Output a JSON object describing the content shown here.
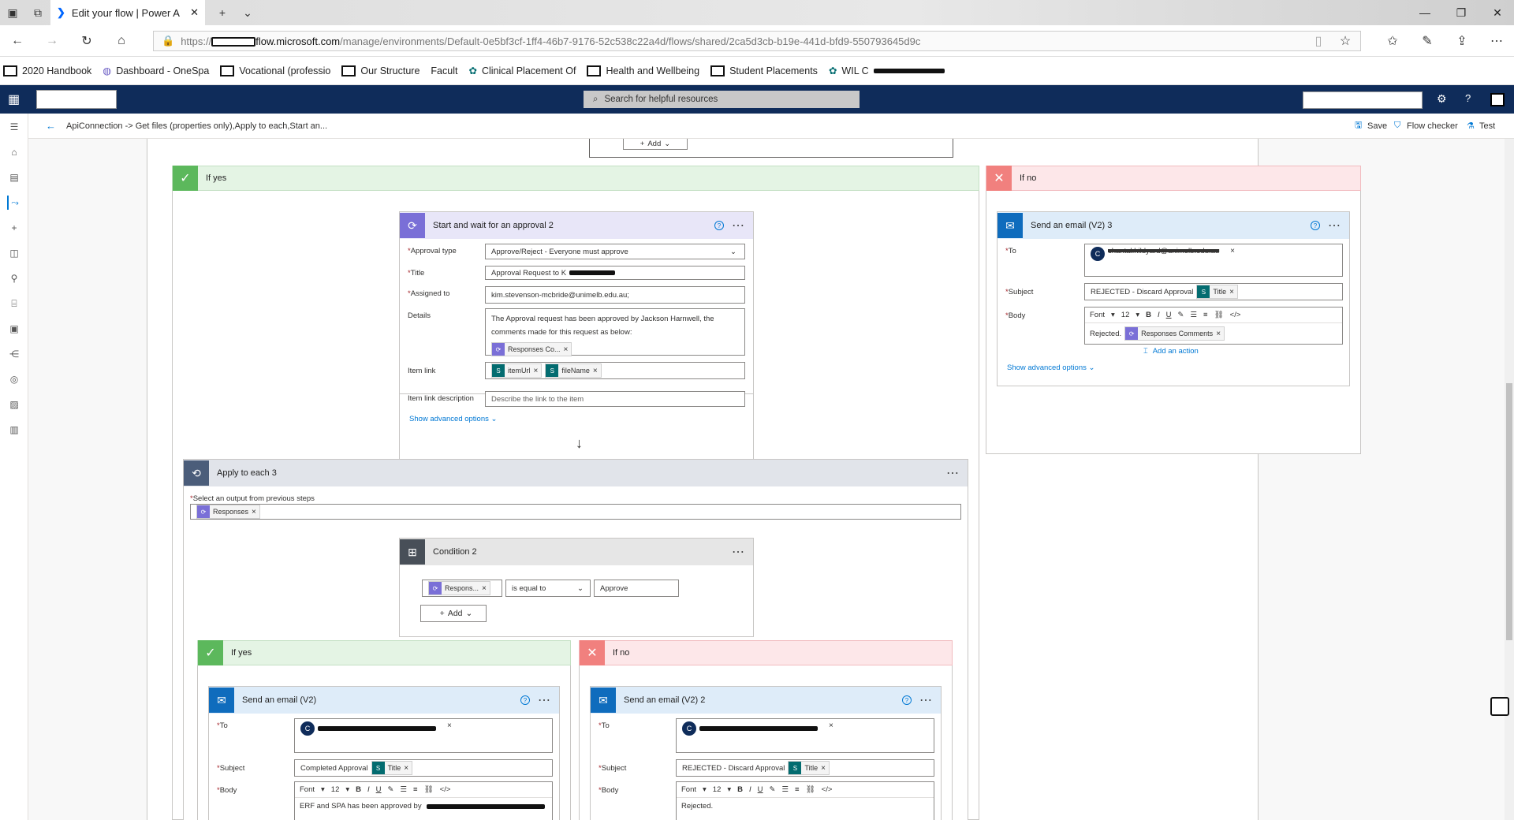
{
  "browser": {
    "tab_title": "Edit your flow | Power A",
    "url_prefix": "https://",
    "url_domain": "flow.microsoft.com",
    "url_path": "/manage/environments/Default-0e5bf3cf-1ff4-46b7-9176-52c538c22a4d/flows/shared/2ca5d3cb-b19e-441d-bfd9-550793645d9c",
    "bookmarks": [
      "2020 Handbook",
      "Dashboard - OneSpa",
      "Vocational (professio",
      "Our Structure",
      "Facult",
      "Clinical Placement Of",
      "Health and Wellbeing",
      "Student Placements",
      "WIL C"
    ]
  },
  "app": {
    "search_placeholder": "Search for helpful resources",
    "breadcrumb": "ApiConnection -> Get files (properties only),Apply to each,Start an...",
    "save_label": "Save",
    "flow_checker_label": "Flow checker",
    "test_label": "Test"
  },
  "canvas": {
    "top_add_label": "Add",
    "if_yes_label": "If yes",
    "if_no_label": "If no",
    "approval": {
      "title": "Start and wait for an approval 2",
      "approval_type_label": "Approval type",
      "approval_type_value": "Approve/Reject - Everyone must approve",
      "title_label": "Title",
      "title_value": "Approval Request to K",
      "assigned_label": "Assigned to",
      "assigned_value": "kim.stevenson-mcbride@unimelb.edu.au;",
      "details_label": "Details",
      "details_value": "The Approval request has been approved by Jackson Harnwell, the comments made for this request as below:",
      "details_token": "Responses Co...",
      "item_link_label": "Item link",
      "item_link_token1": "itemUrl",
      "item_link_token2": "fileName",
      "item_link_desc_label": "Item link description",
      "item_link_desc_placeholder": "Describe the link to the item",
      "advanced": "Show advanced options"
    },
    "email3": {
      "title": "Send an email (V2) 3",
      "to_label": "To",
      "to_avatar": "C",
      "to_value": "chantal.hildyard@unimelb.edu.au",
      "subject_label": "Subject",
      "subject_value": "REJECTED - Discard Approval",
      "subject_token": "Title",
      "body_label": "Body",
      "font": "Font",
      "size": "12",
      "body_text": "Rejected.",
      "body_token": "Responses Comments",
      "advanced": "Show advanced options",
      "add_action": "Add an action"
    },
    "apply_each": {
      "title": "Apply to each 3",
      "select_label": "Select an output from previous steps",
      "token": "Responses"
    },
    "condition": {
      "title": "Condition 2",
      "left_token": "Respons...",
      "operator": "is equal to",
      "value": "Approve",
      "add_label": "Add"
    },
    "inner_yes": {
      "label": "If yes",
      "email_title": "Send an email (V2)",
      "to_label": "To",
      "to_avatar": "C",
      "subject_label": "Subject",
      "subject_value": "Completed Approval",
      "subject_token": "Title",
      "body_label": "Body",
      "font": "Font",
      "size": "12",
      "body_text": "ERF and SPA has been approved by"
    },
    "inner_no": {
      "label": "If no",
      "email_title": "Send an email (V2) 2",
      "to_label": "To",
      "to_avatar": "C",
      "subject_label": "Subject",
      "subject_value": "REJECTED - Discard Approval",
      "subject_token": "Title",
      "body_label": "Body",
      "font": "Font",
      "size": "12",
      "body_text": "Rejected."
    }
  },
  "colors": {
    "header": "#0f2c5a",
    "approval": "#7a6fd7",
    "outlook": "#0f6cbd",
    "sharepoint": "#036c70",
    "loop": "#4b5d7a",
    "condition": "#484f58"
  }
}
